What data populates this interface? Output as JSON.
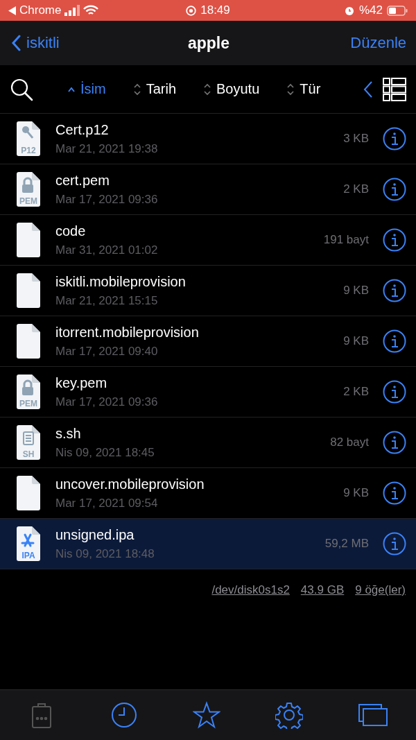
{
  "status_bar": {
    "back_app": "Chrome",
    "time": "18:49",
    "battery": "%42"
  },
  "nav": {
    "back": "iskitli",
    "title": "apple",
    "action": "Düzenle"
  },
  "sort_options": [
    {
      "label": "İsim",
      "selected": true
    },
    {
      "label": "Tarih",
      "selected": false
    },
    {
      "label": "Boyutu",
      "selected": false
    },
    {
      "label": "Tür",
      "selected": false
    }
  ],
  "files": [
    {
      "kind": "key",
      "badge": "P12",
      "name": "Cert.p12",
      "date": "Mar 21, 2021 19:38",
      "size": "3 KB",
      "selected": false
    },
    {
      "kind": "lock",
      "badge": "PEM",
      "name": "cert.pem",
      "date": "Mar 17, 2021 09:36",
      "size": "2 KB",
      "selected": false
    },
    {
      "kind": "blank",
      "name": "code",
      "date": "Mar 31, 2021 01:02",
      "size": "191 bayt",
      "selected": false
    },
    {
      "kind": "blank",
      "name": "iskitli.mobileprovision",
      "date": "Mar 21, 2021 15:15",
      "size": "9 KB",
      "selected": false
    },
    {
      "kind": "blank",
      "name": "itorrent.mobileprovision",
      "date": "Mar 17, 2021 09:40",
      "size": "9 KB",
      "selected": false
    },
    {
      "kind": "lock",
      "badge": "PEM",
      "name": "key.pem",
      "date": "Mar 17, 2021 09:36",
      "size": "2 KB",
      "selected": false
    },
    {
      "kind": "script",
      "badge": "SH",
      "name": "s.sh",
      "date": "Nis 09, 2021 18:45",
      "size": "82 bayt",
      "selected": false
    },
    {
      "kind": "blank",
      "name": "uncover.mobileprovision",
      "date": "Mar 17, 2021 09:54",
      "size": "9 KB",
      "selected": false
    },
    {
      "kind": "app",
      "badge": "IPA",
      "name": "unsigned.ipa",
      "date": "Nis 09, 2021 18:48",
      "size": "59,2 MB",
      "selected": true
    }
  ],
  "footer_links": [
    "/dev/disk0s1s2",
    "43.9 GB",
    "9 öğe(ler)"
  ],
  "tab_bar": [
    {
      "kind": "clipboard",
      "disabled": true
    },
    {
      "kind": "clock",
      "disabled": false
    },
    {
      "kind": "star",
      "disabled": false
    },
    {
      "kind": "gear",
      "disabled": false
    },
    {
      "kind": "windows",
      "disabled": false
    }
  ]
}
